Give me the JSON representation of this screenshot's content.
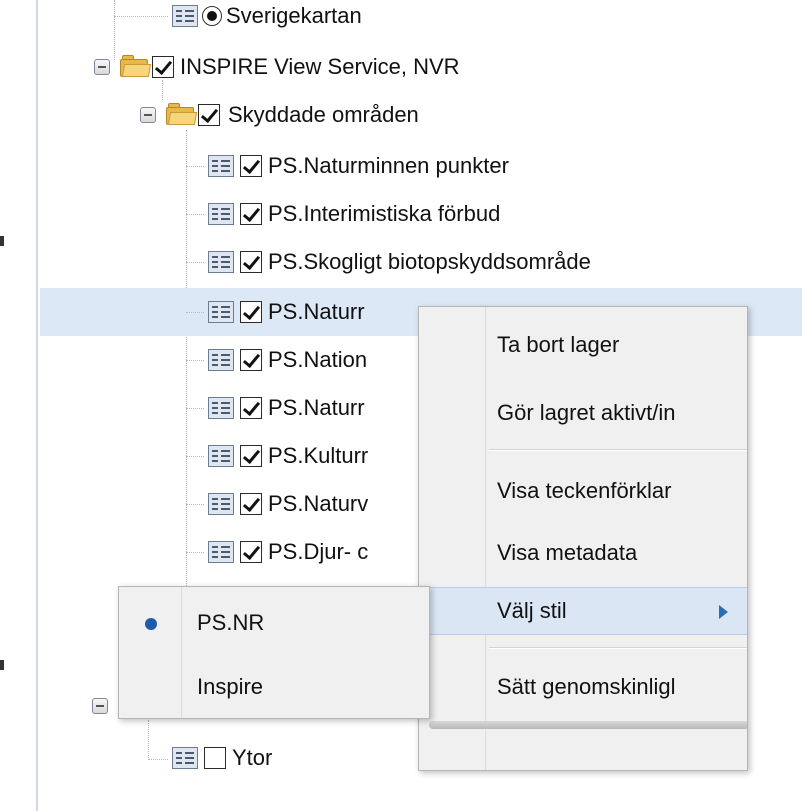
{
  "tree": {
    "items": [
      {
        "label": "Sverigekartan"
      },
      {
        "label": "INSPIRE View Service, NVR"
      },
      {
        "label": "Skyddade områden"
      },
      {
        "label": "PS.Naturminnen punkter"
      },
      {
        "label": "PS.Interimistiska förbud"
      },
      {
        "label": "PS.Skogligt biotopskyddsområde"
      },
      {
        "label": "PS.Naturr"
      },
      {
        "label": "PS.Nation"
      },
      {
        "label": "PS.Naturr"
      },
      {
        "label": "PS.Kulturr"
      },
      {
        "label": "PS.Naturv"
      },
      {
        "label": "PS.Djur- c"
      },
      {
        "label": "Ytor"
      }
    ]
  },
  "context_menu": {
    "items": [
      {
        "label": "Ta bort lager"
      },
      {
        "label": "Gör lagret aktivt/in"
      },
      {
        "label": "Visa teckenförklar"
      },
      {
        "label": "Visa metadata"
      },
      {
        "label": "Välj stil"
      },
      {
        "label": "Sätt genomskinligl"
      }
    ]
  },
  "style_submenu": {
    "items": [
      {
        "label": "PS.NR",
        "selected": true
      },
      {
        "label": "Inspire",
        "selected": false
      }
    ]
  },
  "colors": {
    "selection": "#dde8f6",
    "menu_bg": "#f0f0f0",
    "accent": "#2b6cb8",
    "folder": "#e8b84a"
  }
}
